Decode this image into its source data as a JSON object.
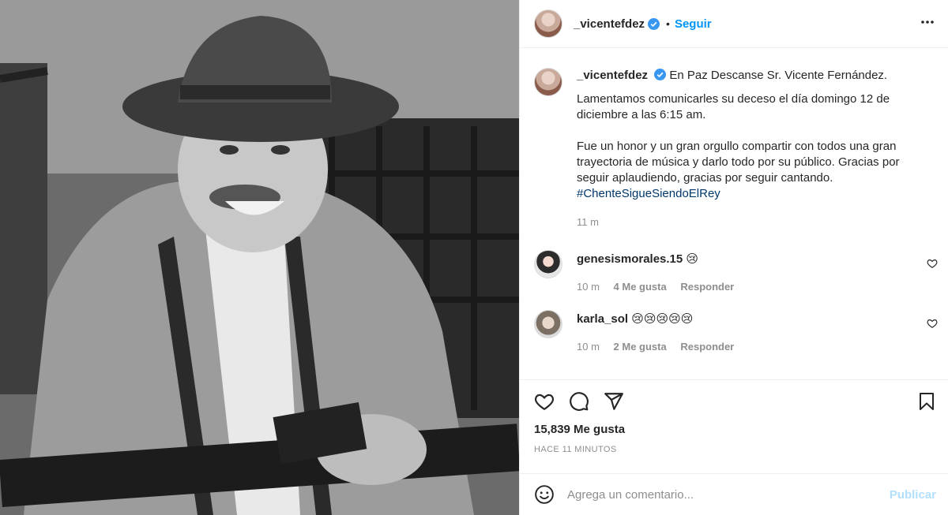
{
  "post": {
    "username": "_vicentefdez",
    "follow_label": "Seguir",
    "dot": "•"
  },
  "caption": {
    "username": "_vicentefdez",
    "title": "En Paz Descanse Sr. Vicente Fernández.",
    "paragraph1": "Lamentamos comunicarles su deceso el día domingo 12 de diciembre a las 6:15 am.",
    "paragraph2": "Fue un honor y un gran orgullo compartir con todos una gran trayectoria de música y darlo todo por su público. Gracias por seguir aplaudiendo, gracias por seguir cantando.",
    "hashtag": "#ChenteSigueSiendoElRey",
    "time": "11 m"
  },
  "comments": [
    {
      "username": "genesismorales.15",
      "text": "😢",
      "time": "10 m",
      "likes": "4 Me gusta",
      "reply": "Responder"
    },
    {
      "username": "karla_sol",
      "text": "😢😢😢😢😢",
      "time": "10 m",
      "likes": "2 Me gusta",
      "reply": "Responder"
    }
  ],
  "stats": {
    "likes": "15,839 Me gusta",
    "ago": "HACE 11 MINUTOS"
  },
  "composer": {
    "placeholder": "Agrega un comentario...",
    "publish_label": "Publicar"
  },
  "colors": {
    "accent": "#0095f6",
    "publish_disabled": "#b2dffc",
    "verified": "#3897f0"
  },
  "icons": [
    "verified-badge-icon",
    "more-options-icon",
    "heart-icon",
    "comment-icon",
    "share-icon",
    "bookmark-icon",
    "emoji-icon"
  ]
}
